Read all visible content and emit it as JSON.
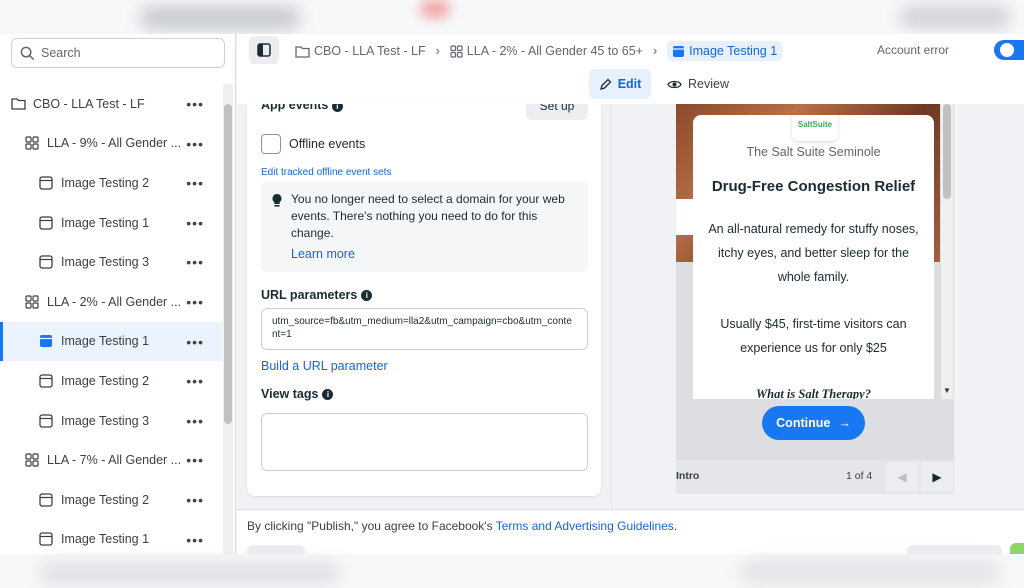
{
  "search": {
    "placeholder": "Search"
  },
  "tree": [
    {
      "label": "CBO - LLA Test - LF",
      "type": "campaign",
      "level": 0,
      "active": false
    },
    {
      "label": "LLA - 9% - All Gender ...",
      "type": "adset",
      "level": 1,
      "active": false
    },
    {
      "label": "Image Testing 2",
      "type": "ad",
      "level": 2,
      "active": false
    },
    {
      "label": "Image Testing 1",
      "type": "ad",
      "level": 2,
      "active": false
    },
    {
      "label": "Image Testing 3",
      "type": "ad",
      "level": 2,
      "active": false
    },
    {
      "label": "LLA - 2% - All Gender ...",
      "type": "adset",
      "level": 1,
      "active": false
    },
    {
      "label": "Image Testing 1",
      "type": "ad",
      "level": 2,
      "active": true
    },
    {
      "label": "Image Testing 2",
      "type": "ad",
      "level": 2,
      "active": false
    },
    {
      "label": "Image Testing 3",
      "type": "ad",
      "level": 2,
      "active": false
    },
    {
      "label": "LLA - 7% - All Gender ...",
      "type": "adset",
      "level": 1,
      "active": false
    },
    {
      "label": "Image Testing 2",
      "type": "ad",
      "level": 2,
      "active": false
    },
    {
      "label": "Image Testing 1",
      "type": "ad",
      "level": 2,
      "active": false
    }
  ],
  "breadcrumb": {
    "campaign": "CBO - LLA Test - LF",
    "adset": "LLA - 2% - All Gender 45 to 65+",
    "ad": "Image Testing 1"
  },
  "topbar": {
    "account_status": "Account error"
  },
  "modes": {
    "edit": "Edit",
    "review": "Review"
  },
  "form": {
    "app_events_label": "App events",
    "setup_label": "Set up",
    "offline_events_label": "Offline events",
    "edit_offline_link": "Edit tracked offline event sets",
    "notice_text": "You no longer need to select a domain for your web events. There's nothing you need to do for this change.",
    "learn_more": "Learn more",
    "url_params_label": "URL parameters",
    "url_params_value": "utm_source=fb&utm_medium=lla2&utm_campaign=cbo&utm_content=1",
    "build_url_link": "Build a URL parameter",
    "view_tags_label": "View tags"
  },
  "preview": {
    "logo_text": "SaltSuite",
    "brand": "The Salt Suite Seminole",
    "title": "Drug-Free Congestion Relief",
    "body": "An all-natural remedy for stuffy noses, itchy eyes, and better sleep for the whole family.",
    "offer": "Usually $45, first-time visitors can experience us for only $25",
    "question": "What is Salt Therapy?",
    "continue_label": "Continue",
    "pager_label": "Intro",
    "pager_count": "1 of 4"
  },
  "footer": {
    "terms_prefix": "By clicking \"Publish,\" you agree to Facebook's ",
    "terms_link": "Terms and Advertising Guidelines",
    "terms_suffix": "."
  },
  "colors": {
    "accent": "#1877f2",
    "link": "#1466d8",
    "active_bg": "#ebf3ff"
  }
}
